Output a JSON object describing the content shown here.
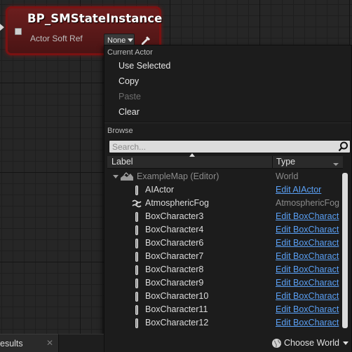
{
  "node": {
    "title": "BP_SMStateInstance",
    "subtitle": "Actor Soft Ref",
    "combo_value": "None",
    "picker_icon": "eyedropper-icon",
    "color": "#7a1212"
  },
  "menu": {
    "current_actor_header": "Current Actor",
    "items": {
      "use_selected": "Use Selected",
      "copy": "Copy",
      "paste": "Paste",
      "clear": "Clear"
    },
    "browse_header": "Browse",
    "search": {
      "placeholder": "Search...",
      "value": ""
    },
    "columns": {
      "label": "Label",
      "type": "Type"
    },
    "root": {
      "name": "ExampleMap (Editor)",
      "type": "World"
    },
    "rows": [
      {
        "name": "AIActor",
        "type": "Edit AIActor",
        "is_link": true,
        "icon": "actor-icon"
      },
      {
        "name": "AtmosphericFog",
        "type": "AtmosphericFog",
        "is_link": false,
        "icon": "fog-icon"
      },
      {
        "name": "BoxCharacter3",
        "type": "Edit BoxCharact",
        "is_link": true,
        "icon": "actor-icon"
      },
      {
        "name": "BoxCharacter4",
        "type": "Edit BoxCharact",
        "is_link": true,
        "icon": "actor-icon"
      },
      {
        "name": "BoxCharacter6",
        "type": "Edit BoxCharact",
        "is_link": true,
        "icon": "actor-icon"
      },
      {
        "name": "BoxCharacter7",
        "type": "Edit BoxCharact",
        "is_link": true,
        "icon": "actor-icon"
      },
      {
        "name": "BoxCharacter8",
        "type": "Edit BoxCharact",
        "is_link": true,
        "icon": "actor-icon"
      },
      {
        "name": "BoxCharacter9",
        "type": "Edit BoxCharact",
        "is_link": true,
        "icon": "actor-icon"
      },
      {
        "name": "BoxCharacter10",
        "type": "Edit BoxCharact",
        "is_link": true,
        "icon": "actor-icon"
      },
      {
        "name": "BoxCharacter11",
        "type": "Edit BoxCharact",
        "is_link": true,
        "icon": "actor-icon"
      },
      {
        "name": "BoxCharacter12",
        "type": "Edit BoxCharact",
        "is_link": true,
        "icon": "actor-icon"
      }
    ],
    "choose_world": "Choose World",
    "link_color": "#5aa0f5"
  },
  "results_tab": {
    "label": "esults",
    "close": "✕"
  }
}
